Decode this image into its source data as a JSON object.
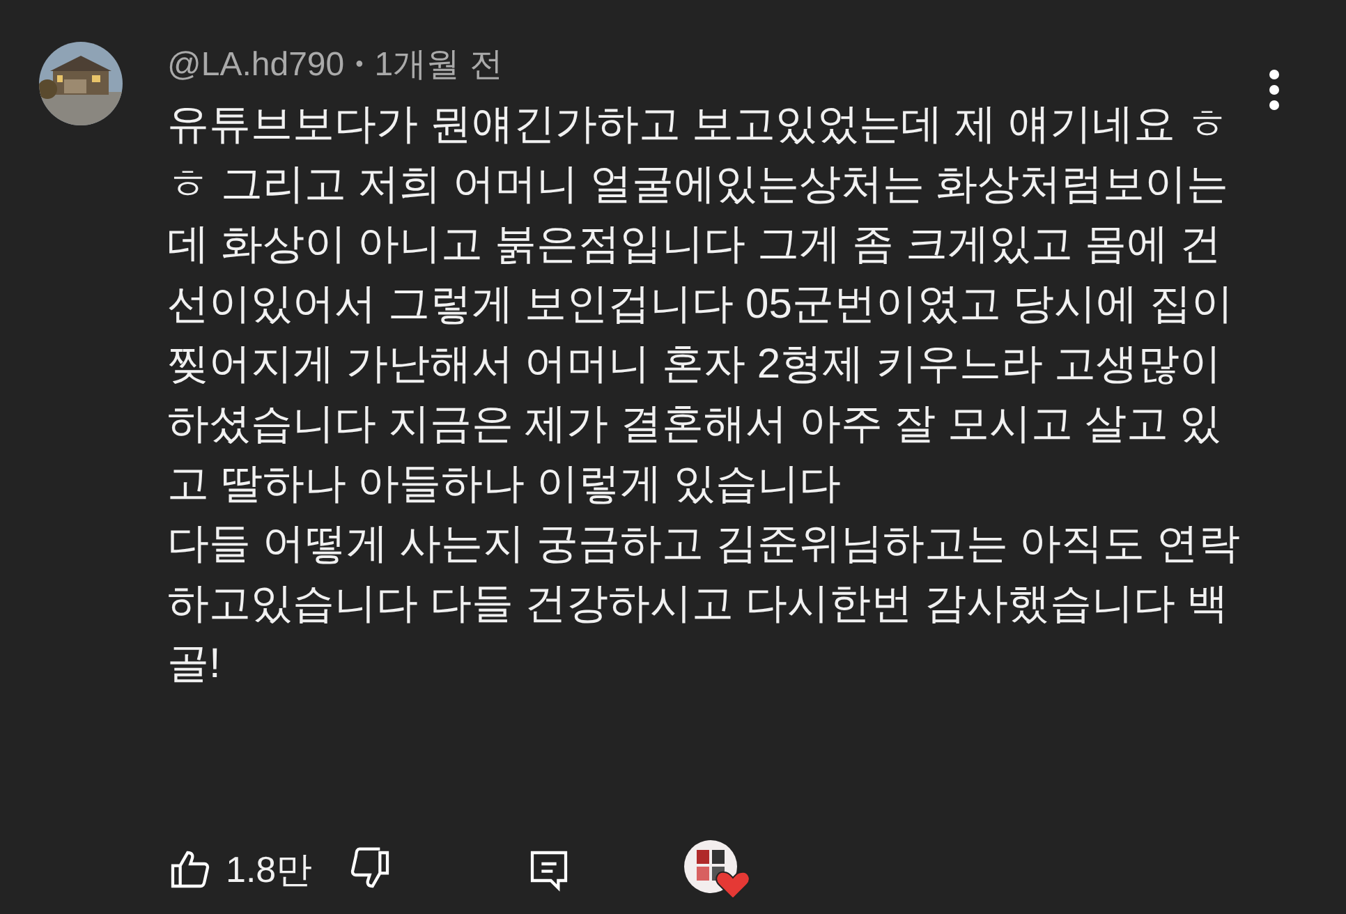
{
  "comment": {
    "author": "@LA.hd790",
    "separator": "•",
    "time": "1개월 전",
    "paragraphs": [
      "유튜브보다가 뭔얘긴가하고 보고있었는데 제 얘기네요 ㅎㅎ 그리고 저희 어머니 얼굴에있는상처는 화상처럼보이는데 화상이 아니고 붉은점입니다 그게 좀 크게있고 몸에 건선이있어서 그렇게 보인겁니다 05군번이였고 당시에 집이 찢어지게 가난해서 어머니 혼자 2형제 키우느라 고생많이하셨습니다 지금은 제가 결혼해서 아주 잘 모시고 살고 있고 딸하나 아들하나 이렇게 있습니다",
      "다들 어떻게 사는지 궁금하고 김준위님하고는 아직도 연락하고있습니다 다들 건강하시고 다시한번 감사했습니다 백골!"
    ],
    "likes": "1.8만",
    "creator_hearted": true
  }
}
